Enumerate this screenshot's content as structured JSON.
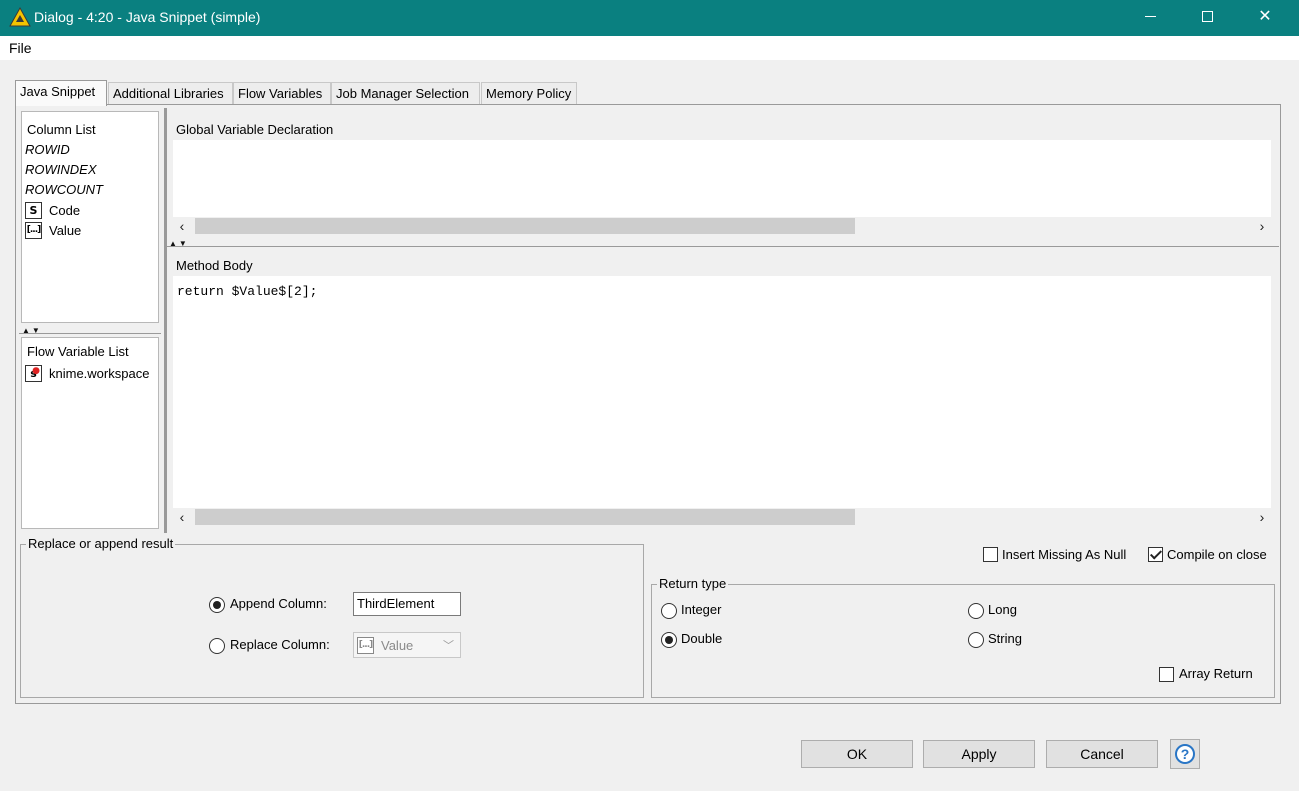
{
  "window": {
    "title": "Dialog - 4:20 - Java Snippet (simple)"
  },
  "menu": {
    "file_label": "File"
  },
  "tabs": [
    {
      "label": "Java Snippet",
      "active": true
    },
    {
      "label": "Additional Libraries",
      "active": false
    },
    {
      "label": "Flow Variables",
      "active": false
    },
    {
      "label": "Job Manager Selection",
      "active": false
    },
    {
      "label": "Memory Policy",
      "active": false
    }
  ],
  "column_list": {
    "title": "Column List",
    "special": [
      "ROWID",
      "ROWINDEX",
      "ROWCOUNT"
    ],
    "columns": [
      {
        "type_glyph": "S",
        "name": "Code"
      },
      {
        "type_glyph": "[...]",
        "name": "Value"
      }
    ]
  },
  "flow_variable_list": {
    "title": "Flow Variable List",
    "items": [
      {
        "type_glyph": "s",
        "name": "knime.workspace"
      }
    ]
  },
  "global_declaration": {
    "title": "Global Variable Declaration",
    "code": ""
  },
  "method_body": {
    "title": "Method Body",
    "code": "return $Value$[2];"
  },
  "replace_append": {
    "title": "Replace or append result",
    "append_label": "Append Column:",
    "append_value": "ThirdElement",
    "replace_label": "Replace Column:",
    "replace_value": "Value",
    "replace_type_glyph": "[...]",
    "selected": "append"
  },
  "options": {
    "insert_missing_label": "Insert Missing As Null",
    "insert_missing_checked": false,
    "compile_on_close_label": "Compile on close",
    "compile_on_close_checked": true
  },
  "return_type": {
    "title": "Return type",
    "integer_label": "Integer",
    "long_label": "Long",
    "double_label": "Double",
    "string_label": "String",
    "selected": "Double",
    "array_return_label": "Array Return",
    "array_return_checked": false
  },
  "buttons": {
    "ok": "OK",
    "apply": "Apply",
    "cancel": "Cancel",
    "help": "?"
  },
  "colors": {
    "titlebar": "#0a8080",
    "logo": "#f5c400"
  }
}
